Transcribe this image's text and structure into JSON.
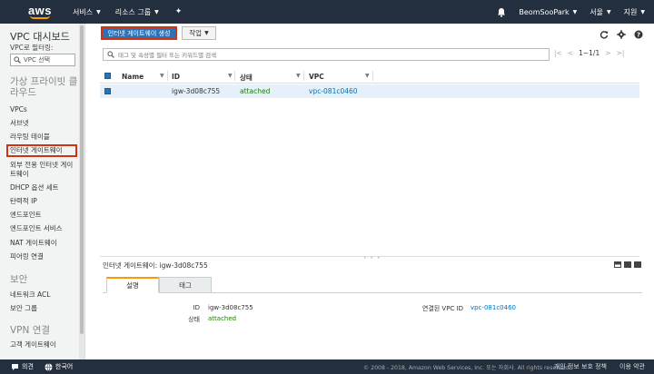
{
  "topnav": {
    "logo": "aws",
    "services": "서비스",
    "resource_groups": "리소스 그룹",
    "user": "BeomSooPark",
    "region": "서울",
    "support": "지원"
  },
  "sidebar": {
    "title": "VPC 대시보드",
    "filter_label": "VPC로 필터링:",
    "filter_placeholder": "VPC 선택",
    "section_private_cloud": "가상 프라이빗 클라우드",
    "items": [
      "VPCs",
      "서브넷",
      "라우팅 테이블",
      "인터넷 게이트웨이",
      "외부 전용 인터넷 게이트웨이",
      "DHCP 옵션 세트",
      "탄력적 IP",
      "엔드포인트",
      "엔드포인트 서비스",
      "NAT 게이트웨이",
      "피어링 연결"
    ],
    "section_security": "보안",
    "security_items": [
      "네트워크 ACL",
      "보안 그룹"
    ],
    "section_vpn": "VPN 연결",
    "vpn_items": [
      "고객 게이트웨이"
    ]
  },
  "toolbar": {
    "create_button": "인터넷 게이트웨이 생성",
    "action_button": "작업"
  },
  "search": {
    "placeholder": "태그 및 속성별 필터 또는 키워드별 검색"
  },
  "pager": {
    "count": "1~1/1"
  },
  "table": {
    "columns": [
      "Name",
      "ID",
      "상태",
      "VPC"
    ],
    "rows": [
      {
        "name": "",
        "id": "igw-3d08c755",
        "status": "attached",
        "vpc": "vpc-081c0460"
      }
    ]
  },
  "detail": {
    "title_prefix": "인터넷 게이트웨이:",
    "title_id": "igw-3d08c755",
    "tabs": [
      "설명",
      "태그"
    ],
    "id_label": "ID",
    "id_value": "igw-3d08c755",
    "status_label": "상태",
    "status_value": "attached",
    "vpc_label": "연결된 VPC ID",
    "vpc_value": "vpc-081c0460"
  },
  "footer": {
    "feedback": "의견",
    "language": "한국어",
    "copyright": "© 2008 - 2018, Amazon Web Services, Inc. 또는 자회사. All rights reserved.",
    "privacy": "개인 정보 보호 정책",
    "terms": "이용 약관"
  },
  "colors": {
    "nav_bg": "#232f3e",
    "primary": "#2b73b8",
    "highlight_border": "#d13212",
    "attached": "#1d8102",
    "link": "#0073bb"
  }
}
